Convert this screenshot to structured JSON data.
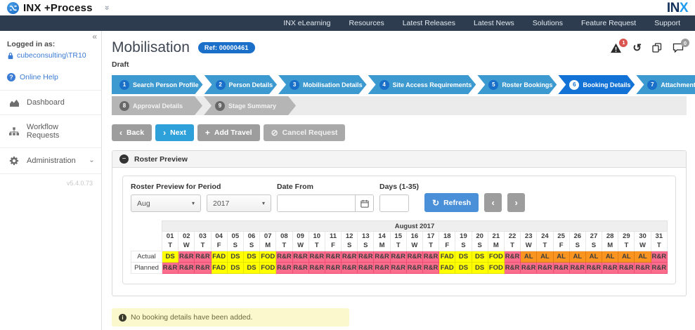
{
  "brand": {
    "app_name": "INX +Process",
    "logo_in": "IN",
    "logo_x": "X"
  },
  "topnav": {
    "items": [
      "INX eLearning",
      "Resources",
      "Latest Releases",
      "Latest News",
      "Solutions",
      "Feature Request",
      "Support"
    ]
  },
  "sidebar": {
    "logged_in_label": "Logged in as:",
    "username": "cubeconsulting\\TR10",
    "online_help_label": "Online Help",
    "nav_items": [
      {
        "id": "dashboard",
        "label": "Dashboard",
        "icon": "dashboard-icon",
        "expandable": false
      },
      {
        "id": "workflow-requests",
        "label": "Workflow Requests",
        "icon": "workflow-icon",
        "expandable": false
      },
      {
        "id": "administration",
        "label": "Administration",
        "icon": "gears-icon",
        "expandable": true
      }
    ],
    "version": "v5.4.0.73"
  },
  "page": {
    "title": "Mobilisation",
    "ref_badge": "Ref: 00000461",
    "status": "Draft",
    "warning_badge_count": "1",
    "chat_badge_count": "0"
  },
  "wizard": {
    "row1": [
      {
        "num": "1",
        "label": "Search Person Profile",
        "active": false
      },
      {
        "num": "2",
        "label": "Person Details",
        "active": false
      },
      {
        "num": "3",
        "label": "Mobilisation Details",
        "active": false
      },
      {
        "num": "4",
        "label": "Site Access Requirements",
        "active": false
      },
      {
        "num": "5",
        "label": "Roster Bookings",
        "active": false
      },
      {
        "num": "6",
        "label": "Booking Details",
        "active": true
      },
      {
        "num": "7",
        "label": "Attachments",
        "active": false
      }
    ],
    "row2": [
      {
        "num": "8",
        "label": "Approval Details"
      },
      {
        "num": "9",
        "label": "Stage Summary"
      }
    ]
  },
  "toolbar": {
    "back_label": "Back",
    "next_label": "Next",
    "add_travel_label": "Add Travel",
    "cancel_label": "Cancel Request"
  },
  "roster_panel": {
    "title": "Roster Preview",
    "filters": {
      "period_label": "Roster Preview for Period",
      "month_value": "Aug",
      "year_value": "2017",
      "date_from_label": "Date From",
      "date_from_value": "",
      "days_label": "Days (1-35)",
      "days_value": "",
      "refresh_label": "Refresh"
    },
    "calendar": {
      "month_header": "August 2017",
      "days": [
        [
          "01",
          "T"
        ],
        [
          "02",
          "W"
        ],
        [
          "03",
          "T"
        ],
        [
          "04",
          "F"
        ],
        [
          "05",
          "S"
        ],
        [
          "06",
          "S"
        ],
        [
          "07",
          "M"
        ],
        [
          "08",
          "T"
        ],
        [
          "09",
          "W"
        ],
        [
          "10",
          "T"
        ],
        [
          "11",
          "F"
        ],
        [
          "12",
          "S"
        ],
        [
          "13",
          "S"
        ],
        [
          "14",
          "M"
        ],
        [
          "15",
          "T"
        ],
        [
          "16",
          "W"
        ],
        [
          "17",
          "T"
        ],
        [
          "18",
          "F"
        ],
        [
          "19",
          "S"
        ],
        [
          "20",
          "S"
        ],
        [
          "21",
          "M"
        ],
        [
          "22",
          "T"
        ],
        [
          "23",
          "W"
        ],
        [
          "24",
          "T"
        ],
        [
          "25",
          "F"
        ],
        [
          "26",
          "S"
        ],
        [
          "27",
          "S"
        ],
        [
          "28",
          "M"
        ],
        [
          "29",
          "T"
        ],
        [
          "30",
          "W"
        ],
        [
          "31",
          "T"
        ]
      ],
      "legend": {
        "DS": "yellow",
        "FAD": "yellow",
        "FOD": "yellow",
        "R&R": "pink",
        "AL": "orange"
      },
      "rows": [
        {
          "label": "Actual",
          "cells": [
            "DS",
            "R&R",
            "R&R",
            "FAD",
            "DS",
            "DS",
            "FOD",
            "R&R",
            "R&R",
            "R&R",
            "R&R",
            "R&R",
            "R&R",
            "R&R",
            "R&R",
            "R&R",
            "R&R",
            "FAD",
            "DS",
            "DS",
            "FOD",
            "R&R",
            "AL",
            "AL",
            "AL",
            "AL",
            "AL",
            "AL",
            "AL",
            "AL",
            "R&R"
          ]
        },
        {
          "label": "Planned",
          "cells": [
            "R&R",
            "R&R",
            "R&R",
            "FAD",
            "DS",
            "DS",
            "FOD",
            "R&R",
            "R&R",
            "R&R",
            "R&R",
            "R&R",
            "R&R",
            "R&R",
            "R&R",
            "R&R",
            "R&R",
            "FAD",
            "DS",
            "DS",
            "FOD",
            "R&R",
            "R&R",
            "R&R",
            "R&R",
            "R&R",
            "R&R",
            "R&R",
            "R&R",
            "R&R",
            "R&R"
          ]
        }
      ]
    }
  },
  "alert": {
    "message": "No booking details have been added."
  },
  "icons": {
    "collapse": "«",
    "double_chevron": "«",
    "question": "?",
    "caret": "▾",
    "chevron_left": "‹",
    "chevron_right": "›",
    "plus": "+",
    "ban": "⊘",
    "minus": "−",
    "info": "i",
    "history": "↺"
  },
  "colors": {
    "navy": "#2d3c4e",
    "link_blue": "#3a7bd5",
    "step_blue": "#3d9ad1",
    "step_active_blue": "#1272d5",
    "badge_blue": "#1a6fc9",
    "button_gray": "#9d9d9d",
    "next_blue": "#2fa1da",
    "refresh_blue": "#4a90d9",
    "cell_yellow": "#ffff00",
    "cell_pink": "#fa6d8d",
    "cell_orange": "#f8941f",
    "alert_bg": "#fbf8cd",
    "badge_red": "#d9534f"
  }
}
